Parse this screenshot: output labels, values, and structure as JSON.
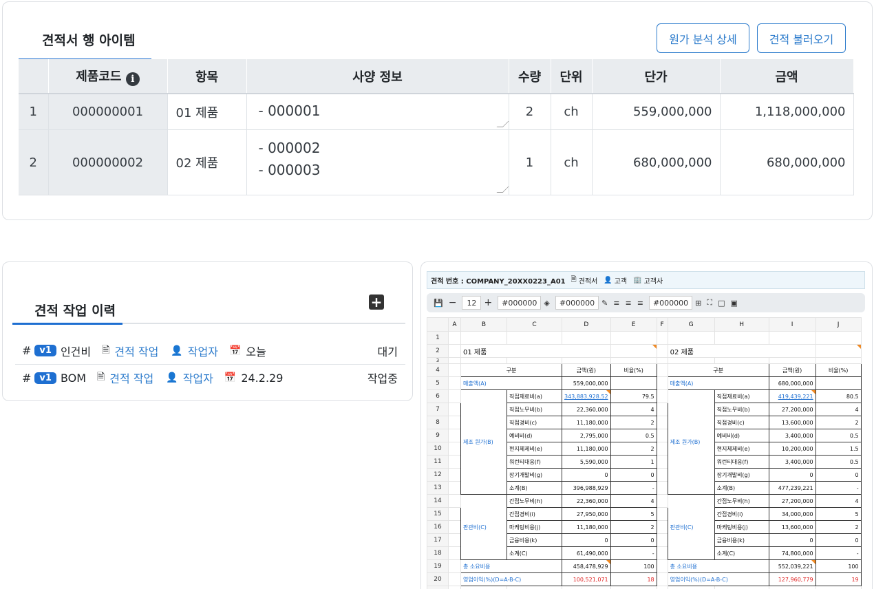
{
  "quote": {
    "title": "견적서 행 아이템",
    "btn_cost": "원가 분석 상세",
    "btn_load": "견적 불러오기",
    "headers": [
      "제품코드",
      "항목",
      "사양 정보",
      "수량",
      "단위",
      "단가",
      "금액"
    ],
    "rows": [
      {
        "no": "1",
        "code": "000000001",
        "item": "01 제품",
        "spec1": "- 000001",
        "spec2": "",
        "qty": "2",
        "unit": "ch",
        "price": "559,000,000",
        "amount": "1,118,000,000"
      },
      {
        "no": "2",
        "code": "000000002",
        "item": "02 제품",
        "spec1": "- 000002",
        "spec2": "- 000003",
        "qty": "1",
        "unit": "ch",
        "price": "680,000,000",
        "amount": "680,000,000"
      }
    ]
  },
  "history": {
    "title": "견적 작업 이력",
    "rows": [
      {
        "hash": "#",
        "ver": "v1",
        "name": "인건비",
        "job": "견적 작업",
        "worker": "작업자",
        "date": "오늘",
        "status": "대기"
      },
      {
        "hash": "#",
        "ver": "v1",
        "name": "BOM",
        "job": "견적 작업",
        "worker": "작업자",
        "date": "24.2.29",
        "status": "작업중"
      }
    ]
  },
  "sheet": {
    "status_label": "견적 번호 : COMPANY_20XX0223_A01",
    "doc_label": "견적서",
    "customer_label": "고객",
    "company_label": "고객사",
    "font_size": "12",
    "color1": "#000000",
    "color2": "#000000",
    "color3": "#000000",
    "cols": [
      "A",
      "B",
      "C",
      "D",
      "E",
      "F",
      "G",
      "H",
      "I",
      "J"
    ],
    "product1": "01 제품",
    "product2": "02 제품",
    "hdr_gubun": "구분",
    "hdr_amount": "금액(원)",
    "hdr_ratio": "비율(%)",
    "sales_label": "매출액(A)",
    "sales1": "559,000,000",
    "sales2": "680,000,000",
    "mfg_label": "제조 원가(B)",
    "sga_label": "판관비(C)",
    "mfg_items": [
      {
        "name": "직접재료비(a)",
        "v1": "343,883,928.52",
        "r1": "79.5",
        "v2": "419,439,221",
        "r2": "80.5"
      },
      {
        "name": "직접노무비(b)",
        "v1": "22,360,000",
        "r1": "4",
        "v2": "27,200,000",
        "r2": "4"
      },
      {
        "name": "직접경비(c)",
        "v1": "11,180,000",
        "r1": "2",
        "v2": "13,600,000",
        "r2": "2"
      },
      {
        "name": "예비비(d)",
        "v1": "2,795,000",
        "r1": "0.5",
        "v2": "3,400,000",
        "r2": "0.5"
      },
      {
        "name": "현지체제비(e)",
        "v1": "11,180,000",
        "r1": "2",
        "v2": "10,200,000",
        "r2": "1.5"
      },
      {
        "name": "워런티대응(f)",
        "v1": "5,590,000",
        "r1": "1",
        "v2": "3,400,000",
        "r2": "0.5"
      },
      {
        "name": "장기개발비(g)",
        "v1": "0",
        "r1": "0",
        "v2": "0",
        "r2": "0"
      },
      {
        "name": "소계(B)",
        "v1": "396,988,929",
        "r1": "-",
        "v2": "477,239,221",
        "r2": "-"
      }
    ],
    "sga_items": [
      {
        "name": "간접노무비(h)",
        "v1": "22,360,000",
        "r1": "4",
        "v2": "27,200,000",
        "r2": "4"
      },
      {
        "name": "간접경비(i)",
        "v1": "27,950,000",
        "r1": "5",
        "v2": "34,000,000",
        "r2": "5"
      },
      {
        "name": "마케팅비용(j)",
        "v1": "11,180,000",
        "r1": "2",
        "v2": "13,600,000",
        "r2": "2"
      },
      {
        "name": "금융비용(k)",
        "v1": "0",
        "r1": "0",
        "v2": "0",
        "r2": "0"
      },
      {
        "name": "소계(C)",
        "v1": "61,490,000",
        "r1": "-",
        "v2": "74,800,000",
        "r2": "-"
      }
    ],
    "total_label": "총 소요비용",
    "total1": "458,478,929",
    "total_r1": "100",
    "total2": "552,039,221",
    "total_r2": "100",
    "profit_label": "영업이익(%)(D=A-B-C)",
    "profit1": "100,521,071",
    "profit_r1": "18",
    "profit2": "127,960,779",
    "profit_r2": "19"
  }
}
